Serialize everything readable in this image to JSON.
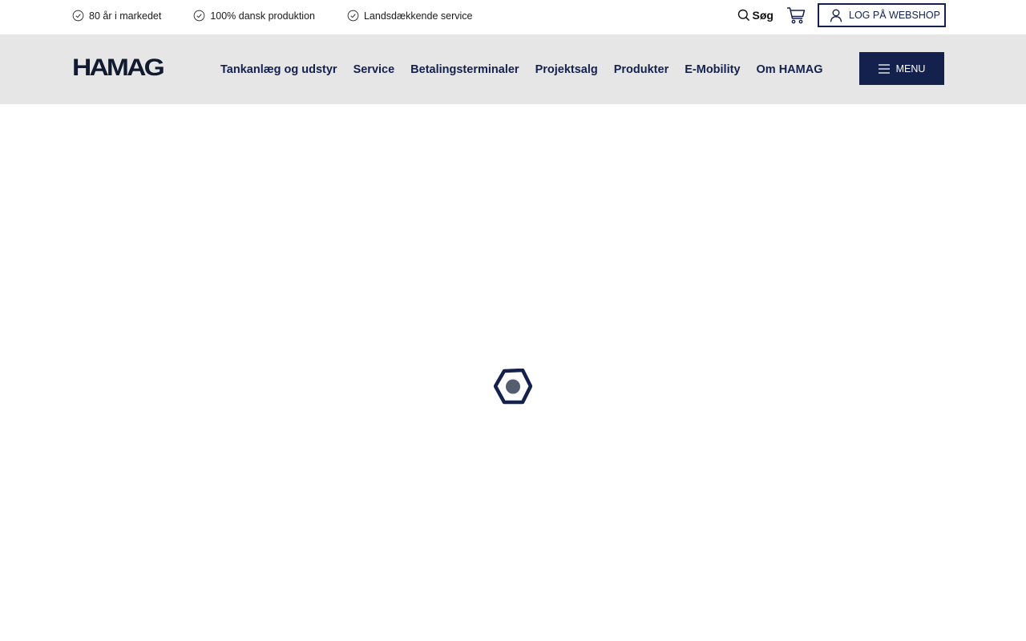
{
  "topbar": {
    "usps": [
      {
        "icon": "check-circle-icon",
        "label": "80 år i markedet"
      },
      {
        "icon": "check-circle-icon",
        "label": "100% dansk produktion"
      },
      {
        "icon": "check-circle-icon",
        "label": "Landsdækkende service"
      }
    ],
    "search_label": "Søg",
    "cart_icon": "cart-icon",
    "login_label": "LOG PÅ WEBSHOP"
  },
  "header": {
    "logo_text": "HAMAG",
    "nav": [
      "Tankanlæg og udstyr",
      "Service",
      "Betalingsterminaler",
      "Projektsalg",
      "Produkter",
      "E-Mobility",
      "Om HAMAG"
    ],
    "menu_label": "MENU"
  },
  "loader": {
    "icon": "hexagon-spinner-icon"
  },
  "colors": {
    "brand_navy": "#14214d",
    "header_bg": "#e6e6e6",
    "loader_core": "#555e6e"
  }
}
